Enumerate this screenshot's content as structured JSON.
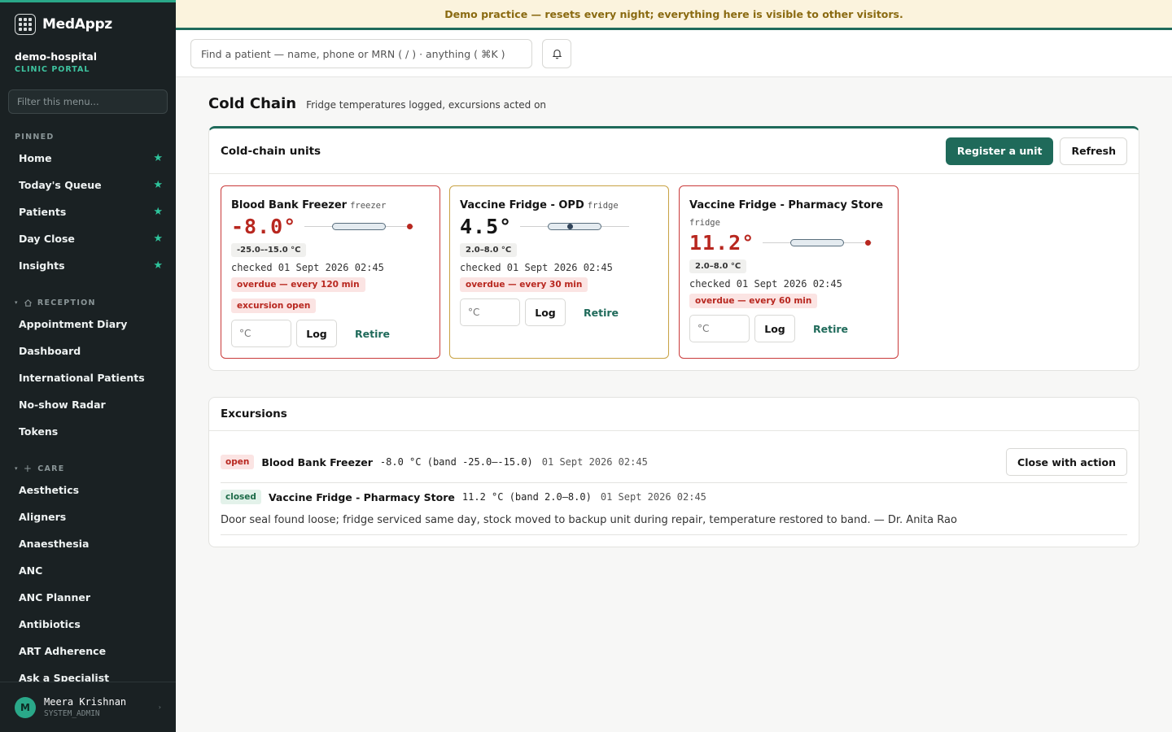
{
  "banner": "Demo practice — resets every night; everything here is visible to other visitors.",
  "brand": {
    "name": "MedAppz",
    "org": "demo-hospital",
    "portal": "CLINIC PORTAL"
  },
  "sidebar": {
    "filter_placeholder": "Filter this menu...",
    "pinned_label": "PINNED",
    "pinned": [
      {
        "label": "Home"
      },
      {
        "label": "Today's Queue"
      },
      {
        "label": "Patients"
      },
      {
        "label": "Day Close"
      },
      {
        "label": "Insights"
      }
    ],
    "reception_label": "RECEPTION",
    "reception": [
      {
        "label": "Appointment Diary"
      },
      {
        "label": "Dashboard"
      },
      {
        "label": "International Patients"
      },
      {
        "label": "No-show Radar"
      },
      {
        "label": "Tokens"
      }
    ],
    "care_label": "CARE",
    "care": [
      {
        "label": "Aesthetics"
      },
      {
        "label": "Aligners"
      },
      {
        "label": "Anaesthesia"
      },
      {
        "label": "ANC"
      },
      {
        "label": "ANC Planner"
      },
      {
        "label": "Antibiotics"
      },
      {
        "label": "ART Adherence"
      },
      {
        "label": "Ask a Specialist"
      }
    ]
  },
  "user": {
    "initial": "M",
    "name": "Meera Krishnan",
    "role": "SYSTEM_ADMIN"
  },
  "search": {
    "placeholder": "Find a patient — name, phone or MRN ( / ) · anything ( ⌘K )"
  },
  "page": {
    "title": "Cold Chain",
    "subtitle": "Fridge temperatures logged, excursions acted on"
  },
  "units_card": {
    "title": "Cold-chain units",
    "register_label": "Register a unit",
    "refresh_label": "Refresh",
    "input_placeholder": "°C",
    "log_label": "Log",
    "retire_label": "Retire",
    "units": [
      {
        "name": "Blood Bank Freezer",
        "kind": "freezer",
        "reading": "-8.0°",
        "range": "-25.0–-15.0 °C",
        "checked": "checked 01 Sept 2026 02:45",
        "overdue": "overdue — every 120 min",
        "excursion": "excursion open",
        "status": "out-of-band"
      },
      {
        "name": "Vaccine Fridge - OPD",
        "kind": "fridge",
        "reading": "4.5°",
        "range": "2.0–8.0 °C",
        "checked": "checked 01 Sept 2026 02:45",
        "overdue": "overdue — every 30 min",
        "status": "in-band"
      },
      {
        "name": "Vaccine Fridge - Pharmacy Store",
        "kind": "fridge",
        "reading": "11.2°",
        "range": "2.0–8.0 °C",
        "checked": "checked 01 Sept 2026 02:45",
        "overdue": "overdue — every 60 min",
        "status": "out-of-band"
      }
    ]
  },
  "excursions_card": {
    "title": "Excursions",
    "rows": [
      {
        "status": "open",
        "unit": "Blood Bank Freezer",
        "value": "-8.0 °C (band -25.0–-15.0)",
        "time": "01 Sept 2026 02:45",
        "action_label": "Close with action"
      },
      {
        "status": "closed",
        "unit": "Vaccine Fridge - Pharmacy Store",
        "value": "11.2 °C (band 2.0–8.0)",
        "time": "01 Sept 2026 02:45",
        "note": "Door seal found loose; fridge serviced same day, stock moved to backup unit during repair, temperature restored to band. — Dr. Anita Rao"
      }
    ]
  },
  "colors": {
    "accent": "#1f6a5a",
    "danger": "#b8271f",
    "mint": "#2aa889",
    "banner_bg": "#fbf3dd",
    "sidebar_bg": "#1a2123"
  }
}
